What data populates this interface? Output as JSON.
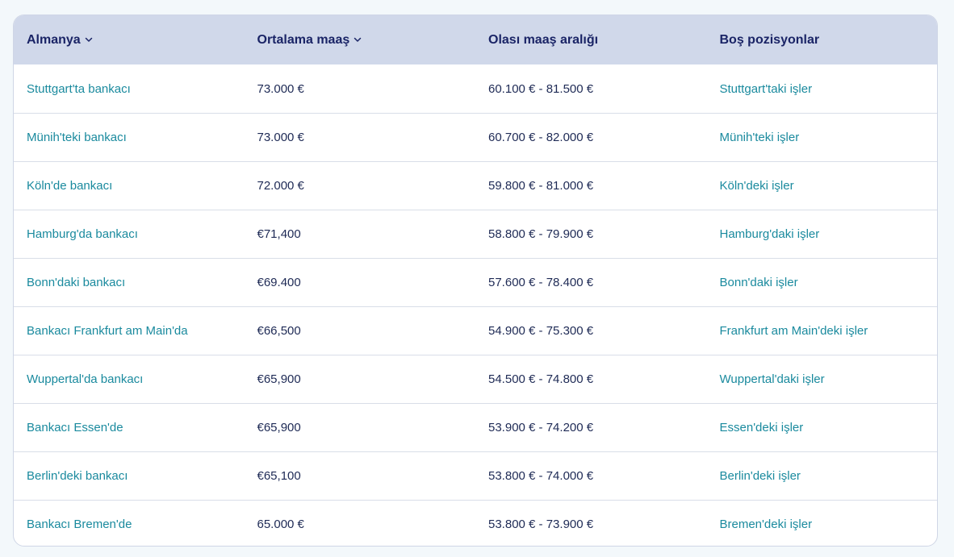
{
  "table": {
    "headers": [
      {
        "label": "Almanya",
        "sortable": true
      },
      {
        "label": "Ortalama maaş",
        "sortable": true
      },
      {
        "label": "Olası maaş aralığı",
        "sortable": false
      },
      {
        "label": "Boş pozisyonlar",
        "sortable": false
      }
    ],
    "rows": [
      {
        "job": "Stuttgart'ta bankacı",
        "avg": "73.000 €",
        "range": "60.100 € - 81.500 €",
        "jobs_link": "Stuttgart'taki işler"
      },
      {
        "job": "Münih'teki bankacı",
        "avg": "73.000 €",
        "range": "60.700 € - 82.000 €",
        "jobs_link": "Münih'teki işler"
      },
      {
        "job": "Köln'de bankacı",
        "avg": "72.000 €",
        "range": "59.800 € - 81.000 €",
        "jobs_link": "Köln'deki işler"
      },
      {
        "job": "Hamburg'da bankacı",
        "avg": "€71,400",
        "range": "58.800 € - 79.900 €",
        "jobs_link": "Hamburg'daki işler"
      },
      {
        "job": "Bonn'daki bankacı",
        "avg": "€69.400",
        "range": "57.600 € - 78.400 €",
        "jobs_link": "Bonn'daki işler"
      },
      {
        "job": "Bankacı Frankfurt am Main'da",
        "avg": "€66,500",
        "range": "54.900 € - 75.300 €",
        "jobs_link": "Frankfurt am Main'deki işler"
      },
      {
        "job": "Wuppertal'da bankacı",
        "avg": "€65,900",
        "range": "54.500 € - 74.800 €",
        "jobs_link": "Wuppertal'daki işler"
      },
      {
        "job": "Bankacı Essen'de",
        "avg": "€65,900",
        "range": "53.900 € - 74.200 €",
        "jobs_link": "Essen'deki işler"
      },
      {
        "job": "Berlin'deki bankacı",
        "avg": "€65,100",
        "range": "53.800 € - 74.000 €",
        "jobs_link": "Berlin'deki işler"
      },
      {
        "job": "Bankacı Bremen'de",
        "avg": "65.000 €",
        "range": "53.800 € - 73.900 €",
        "jobs_link": "Bremen'deki işler"
      }
    ]
  },
  "colors": {
    "header_bg": "#d0d8ea",
    "header_text": "#1a2466",
    "link": "#1a8a9e",
    "body_text": "#1e2a55"
  },
  "icons": {
    "sort": "chevron-down-icon"
  }
}
